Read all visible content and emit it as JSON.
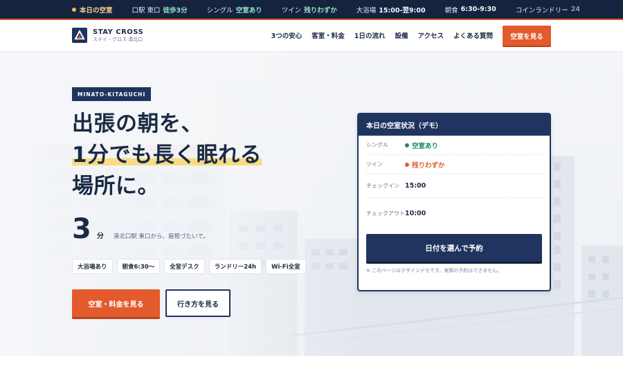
{
  "ticker": {
    "items": [
      {
        "key": "",
        "value": "本日の空室"
      },
      {
        "key": "口駅 東口",
        "value": "徒歩3分"
      },
      {
        "key": "シングル",
        "value": "空室あり"
      },
      {
        "key": "ツイン",
        "value": "残りわずか"
      },
      {
        "key": "大浴場",
        "value": "15:00-翌9:00"
      },
      {
        "key": "朝食",
        "value": "6:30-9:30"
      },
      {
        "key": "コインランドリー",
        "value": "24"
      }
    ]
  },
  "header": {
    "brand_name": "STAY CROSS",
    "brand_sub": "ステイ・クロス 湊北口",
    "nav": [
      "3つの安心",
      "客室・料金",
      "1日の流れ",
      "設備",
      "アクセス",
      "よくある質問"
    ],
    "cta": "空室を見る"
  },
  "hero": {
    "badge": "MINATO-KITAGUCHI",
    "headline": [
      "出張の朝を、",
      "1分でも長く眠れる",
      "場所に。"
    ],
    "stat_number": "3",
    "stat_unit": "分",
    "stat_text": "湊北口駅 東口から、屋根づたいで。",
    "chips": [
      "大浴場あり",
      "朝食6:30〜",
      "全室デスク",
      "ランドリー24h",
      "Wi-Fi全室"
    ],
    "primary_cta": "空室・料金を見る",
    "secondary_cta": "行き方を見る"
  },
  "availability": {
    "title": "本日の空室状況（デモ）",
    "rows": [
      {
        "label": "シングル",
        "value": "空室あり",
        "status": "ok"
      },
      {
        "label": "ツイン",
        "value": "残りわずか",
        "status": "warn"
      },
      {
        "label": "チェックイン",
        "value": "15:00",
        "status": ""
      },
      {
        "label": "チェックアウト",
        "value": "10:00",
        "status": ""
      }
    ],
    "button": "日付を選んで予約",
    "note": "※ このページはデザインデモです。実際の予約はできません。"
  },
  "colors": {
    "navy": "#1f3560",
    "orange": "#e35a2d",
    "green": "#16896a",
    "highlight": "#f7dc82"
  }
}
